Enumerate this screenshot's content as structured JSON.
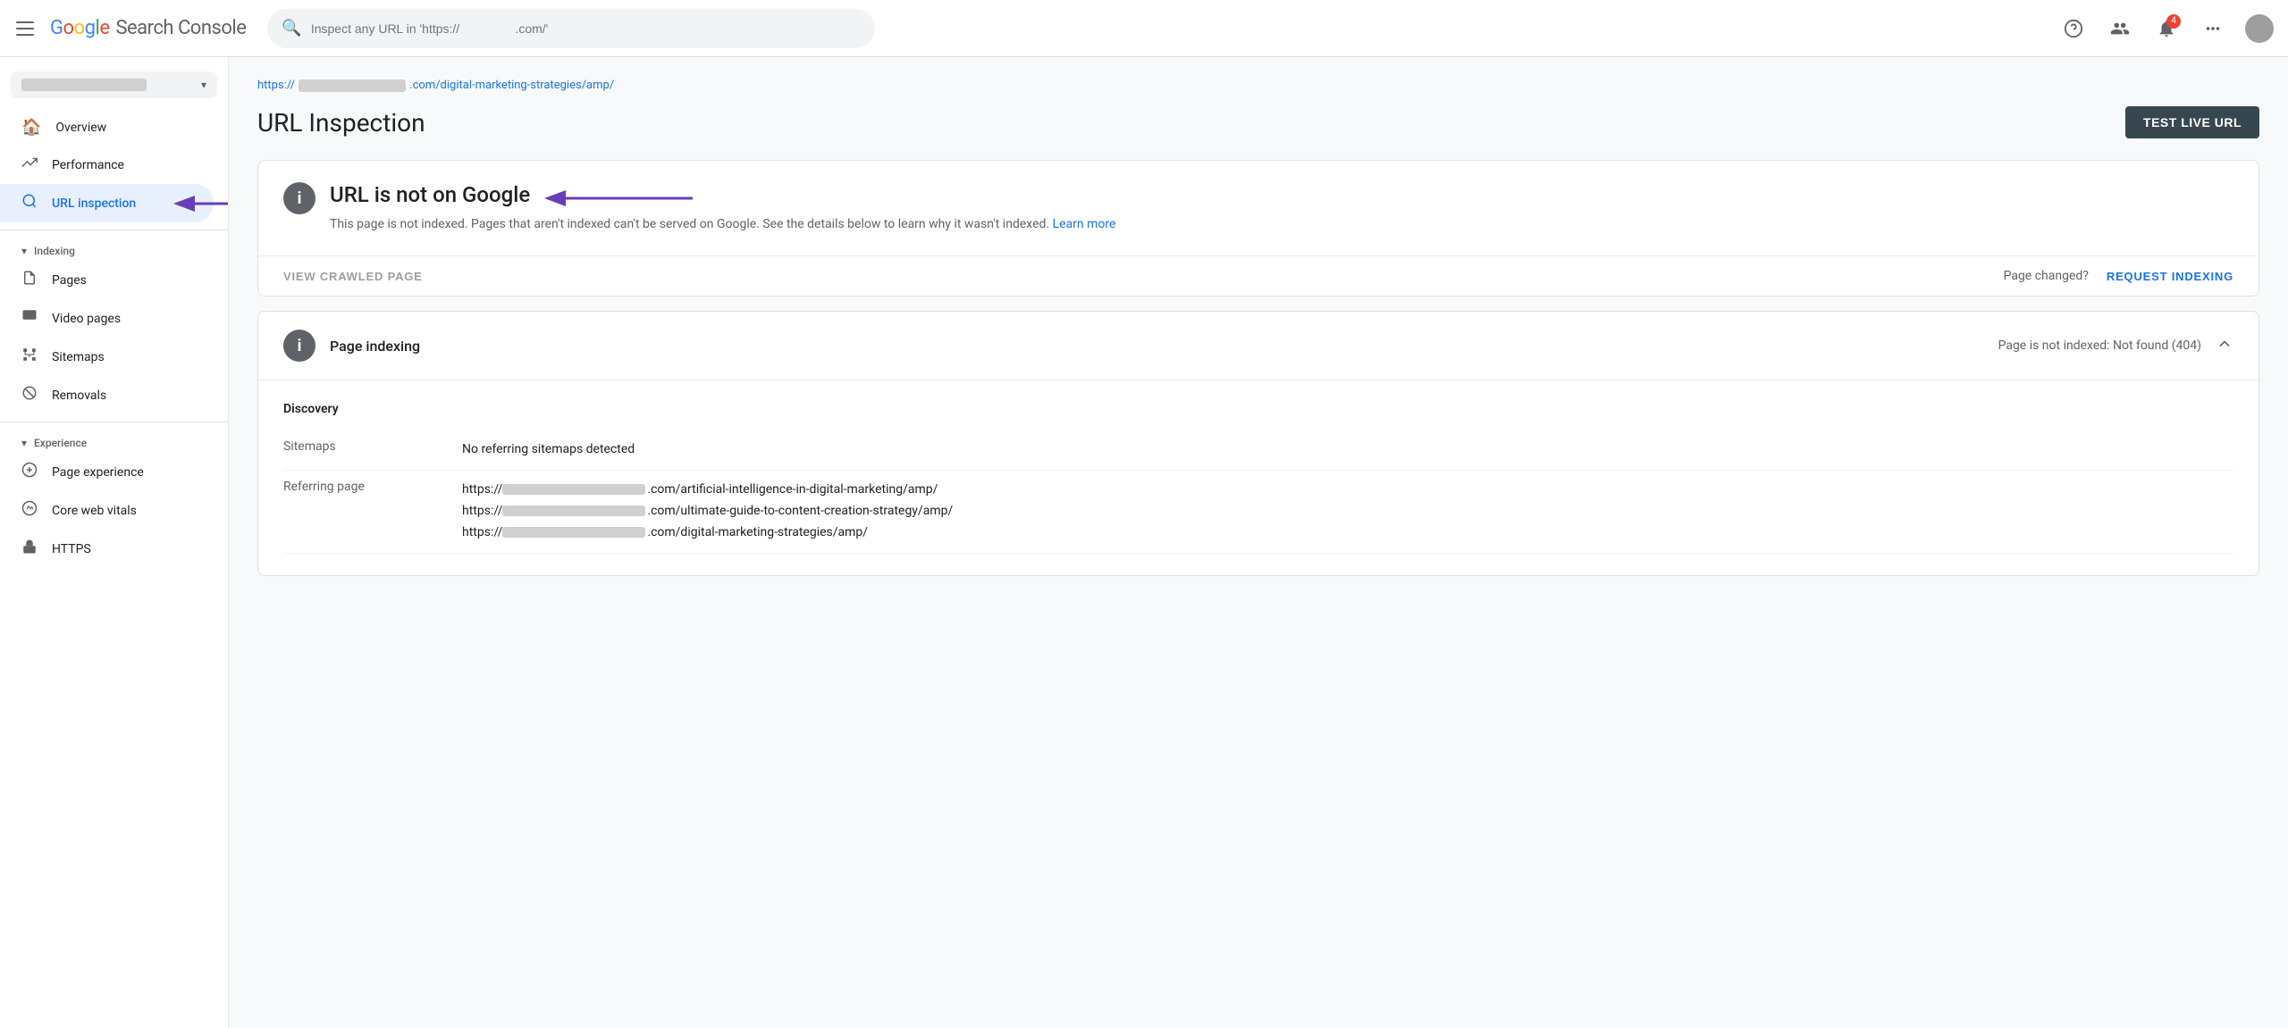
{
  "app": {
    "name": "Google Search Console",
    "logo_parts": [
      "G",
      "o",
      "o",
      "g",
      "l",
      "e"
    ],
    "sc_text": " Search Console"
  },
  "topbar": {
    "search_placeholder": "Inspect any URL in 'https://                .com/'",
    "help_label": "Help",
    "accounts_label": "Accounts",
    "notifications_label": "Notifications",
    "notifications_count": "4",
    "apps_label": "Google apps",
    "avatar_label": "User account"
  },
  "sidebar": {
    "property_placeholder": "site property",
    "nav_items": [
      {
        "id": "overview",
        "label": "Overview",
        "icon": "🏠"
      },
      {
        "id": "performance",
        "label": "Performance",
        "icon": "↗"
      },
      {
        "id": "url-inspection",
        "label": "URL inspection",
        "icon": "🔍",
        "active": true
      }
    ],
    "indexing_section": "Indexing",
    "indexing_items": [
      {
        "id": "pages",
        "label": "Pages",
        "icon": "📄"
      },
      {
        "id": "video-pages",
        "label": "Video pages",
        "icon": "📹"
      },
      {
        "id": "sitemaps",
        "label": "Sitemaps",
        "icon": "🗺"
      },
      {
        "id": "removals",
        "label": "Removals",
        "icon": "🚫"
      }
    ],
    "experience_section": "Experience",
    "experience_items": [
      {
        "id": "page-experience",
        "label": "Page experience",
        "icon": "⊕"
      },
      {
        "id": "core-web-vitals",
        "label": "Core web vitals",
        "icon": "⚡"
      },
      {
        "id": "https",
        "label": "HTTPS",
        "icon": "🔒"
      }
    ]
  },
  "breadcrumb": {
    "url_prefix": "https://",
    "url_suffix": ".com/digital-marketing-strategies/amp/"
  },
  "page": {
    "title": "URL Inspection",
    "test_live_url_label": "TEST LIVE URL"
  },
  "url_card": {
    "status_icon": "i",
    "title": "URL is not on Google",
    "description": "This page is not indexed. Pages that aren't indexed can't be served on Google. See the details below to learn why it wasn't indexed.",
    "learn_more_label": "Learn more",
    "view_crawled_label": "VIEW CRAWLED PAGE",
    "page_changed_label": "Page changed?",
    "request_indexing_label": "REQUEST INDEXING"
  },
  "indexing_card": {
    "title": "Page indexing",
    "status": "Page is not indexed: Not found (404)",
    "sections": [
      {
        "title": "Discovery",
        "rows": [
          {
            "label": "Sitemaps",
            "value": "No referring sitemaps detected"
          },
          {
            "label": "Referring page",
            "urls": [
              {
                "prefix": "https://",
                "middle_blur": true,
                "suffix": ".com/artificial-intelligence-in-digital-marketing/amp/"
              },
              {
                "prefix": "https://",
                "middle_blur": true,
                "suffix": ".com/ultimate-guide-to-content-creation-strategy/amp/"
              },
              {
                "prefix": "https://",
                "middle_blur": true,
                "suffix": ".com/digital-marketing-strategies/amp/"
              }
            ]
          }
        ]
      }
    ]
  }
}
